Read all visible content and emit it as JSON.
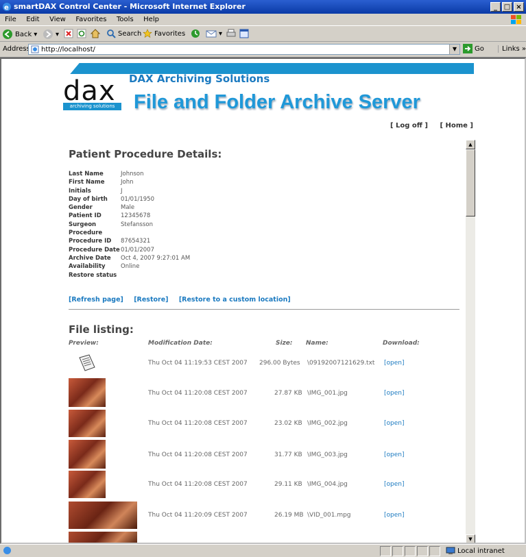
{
  "window": {
    "title": "smartDAX Control Center - Microsoft Internet Explorer"
  },
  "menu": [
    "File",
    "Edit",
    "View",
    "Favorites",
    "Tools",
    "Help"
  ],
  "toolbar": {
    "back": "Back",
    "search": "Search",
    "favorites": "Favorites"
  },
  "address": {
    "label": "Address",
    "url": "http://localhost/",
    "go": "Go",
    "links": "Links"
  },
  "status": {
    "zone": "Local intranet"
  },
  "header": {
    "logo_text": "dax",
    "logo_sub": "archiving solutions",
    "company": "DAX Archiving Solutions",
    "product": "File and Folder Archive Server",
    "logoff": "[ Log off ]",
    "home": "[ Home ]"
  },
  "details": {
    "heading": "Patient Procedure Details:",
    "rows": [
      {
        "label": "Last Name",
        "value": "Johnson"
      },
      {
        "label": "First Name",
        "value": "John"
      },
      {
        "label": "Initials",
        "value": "J"
      },
      {
        "label": "Day of birth",
        "value": "01/01/1950"
      },
      {
        "label": "Gender",
        "value": "Male"
      },
      {
        "label": "Patient ID",
        "value": "12345678"
      },
      {
        "label": "Surgeon",
        "value": "Stefansson"
      },
      {
        "label": "Procedure",
        "value": ""
      },
      {
        "label": "Procedure ID",
        "value": "87654321"
      },
      {
        "label": "Procedure Date",
        "value": "01/01/2007"
      },
      {
        "label": "Archive Date",
        "value": "Oct 4, 2007 9:27:01 AM"
      },
      {
        "label": "Availability",
        "value": "Online"
      },
      {
        "label": "Restore status",
        "value": ""
      }
    ],
    "actions": [
      "[Refresh page]",
      "[Restore]",
      "[Restore to a custom location]"
    ]
  },
  "files": {
    "heading": "File listing:",
    "columns": [
      "Preview:",
      "Modification Date:",
      "Size:",
      "Name:",
      "Download:"
    ],
    "rows": [
      {
        "date": "Thu Oct 04 11:19:53 CEST 2007",
        "size": "296.00 Bytes",
        "name": "\\09192007121629.txt",
        "link": "[open]",
        "preview": "document-icon"
      },
      {
        "date": "Thu Oct 04 11:20:08 CEST 2007",
        "size": "27.87 KB",
        "name": "\\IMG_001.jpg",
        "link": "[open]",
        "preview": "image"
      },
      {
        "date": "Thu Oct 04 11:20:08 CEST 2007",
        "size": "23.02 KB",
        "name": "\\IMG_002.jpg",
        "link": "[open]",
        "preview": "image"
      },
      {
        "date": "Thu Oct 04 11:20:08 CEST 2007",
        "size": "31.77 KB",
        "name": "\\IMG_003.jpg",
        "link": "[open]",
        "preview": "image"
      },
      {
        "date": "Thu Oct 04 11:20:08 CEST 2007",
        "size": "29.11 KB",
        "name": "\\IMG_004.jpg",
        "link": "[open]",
        "preview": "image"
      },
      {
        "date": "Thu Oct 04 11:20:09 CEST 2007",
        "size": "26.19 MB",
        "name": "\\VID_001.mpg",
        "link": "[open]",
        "preview": "video"
      }
    ]
  },
  "colors": {
    "accent": "#1b93ce",
    "link": "#1b7ac0"
  }
}
